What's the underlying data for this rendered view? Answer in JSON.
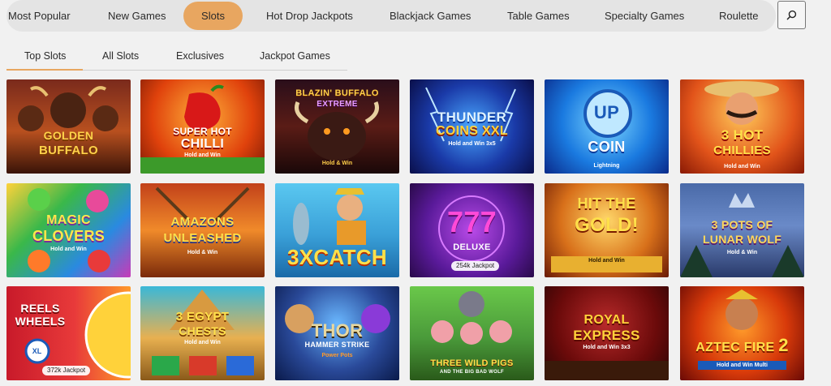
{
  "topnav": {
    "items": [
      {
        "label": "Most Popular"
      },
      {
        "label": "New Games"
      },
      {
        "label": "Slots"
      },
      {
        "label": "Hot Drop Jackpots"
      },
      {
        "label": "Blackjack Games"
      },
      {
        "label": "Table Games"
      },
      {
        "label": "Specialty Games"
      },
      {
        "label": "Roulette"
      }
    ],
    "active_color": "#e8a660",
    "search_icon": "search-icon"
  },
  "subnav": {
    "tabs": [
      {
        "label": "Top Slots"
      },
      {
        "label": "All Slots"
      },
      {
        "label": "Exclusives"
      },
      {
        "label": "Jackpot Games"
      }
    ]
  },
  "games": [
    {
      "title1": "Golden",
      "title2": "Buffalo",
      "sub": ""
    },
    {
      "title1": "Super Hot",
      "title2": "Chilli",
      "sub": "Hold and Win"
    },
    {
      "title1": "Blazin' Buffalo",
      "title2": "Extreme",
      "sub": "Hold & Win"
    },
    {
      "title1": "Thunder",
      "title2": "Coins XXL",
      "sub": "Hold and Win 3x5"
    },
    {
      "title1": "Coin",
      "title2": "Up",
      "sub": "Lightning"
    },
    {
      "title1": "3 Hot",
      "title2": "Chillies",
      "sub": "Hold and Win"
    },
    {
      "title1": "Magic",
      "title2": "Clovers",
      "sub": "Hold and Win"
    },
    {
      "title1": "Amazons",
      "title2": "Unleashed",
      "sub": "Hold & Win"
    },
    {
      "title1": "3x",
      "title2": "Catch",
      "sub": ""
    },
    {
      "title1": "777",
      "title2": "Deluxe",
      "sub": "",
      "jackpot": "254k Jackpot"
    },
    {
      "title1": "Hit the",
      "title2": "Gold!",
      "sub": "Hold and Win"
    },
    {
      "title1": "3 Pots of",
      "title2": "Lunar Wolf",
      "sub": "Hold & Win"
    },
    {
      "title1": "Reels",
      "title2": "Wheels",
      "sub": "XL",
      "jackpot": "372k Jackpot"
    },
    {
      "title1": "3 Egypt",
      "title2": "Chests",
      "sub": "Hold and Win"
    },
    {
      "title1": "Thor",
      "title2": "Hammer Strike",
      "sub": "Power Pots"
    },
    {
      "title1": "Three Wild Pigs",
      "title2": "and the Big Bad Wolf",
      "sub": ""
    },
    {
      "title1": "Royal",
      "title2": "Express",
      "sub": "Hold and Win 3x3"
    },
    {
      "title1": "Aztec Fire",
      "title2": "2",
      "sub": "Hold and Win Multi"
    }
  ]
}
